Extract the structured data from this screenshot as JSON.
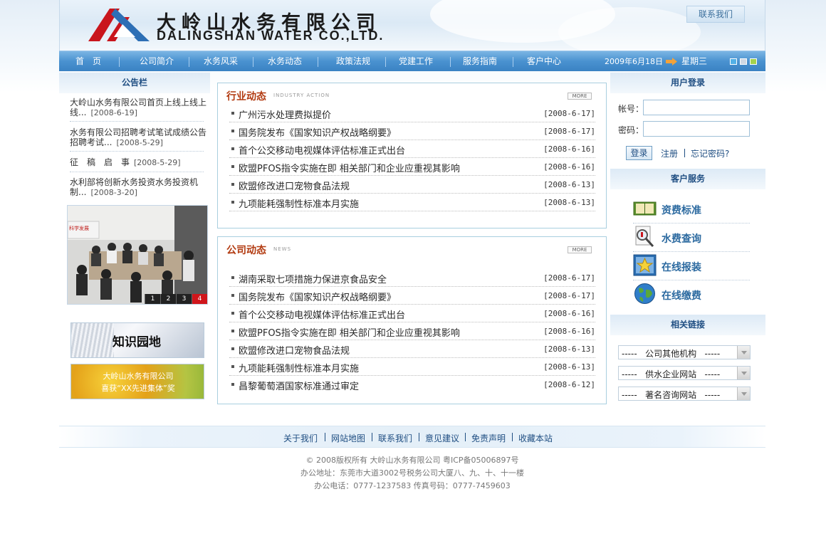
{
  "colors": {
    "nav_blue": "#4a92d0",
    "title_red": "#b23a10",
    "link_blue": "#1f4e82",
    "panel_border": "#a9cfdf"
  },
  "header": {
    "company_cn": "大岭山水务有限公司",
    "company_en": "DALINGSHAN WATER  CO.,LTD.",
    "contact_label": "联系我们",
    "logo_icon": "company-logo-icon"
  },
  "nav": {
    "items": [
      "首　页",
      "公司简介",
      "水务风采",
      "水务动态",
      "政策法规",
      "党建工作",
      "服务指南",
      "客户中心"
    ],
    "date": "2009年6月18日",
    "weekday": "星期三",
    "skin_colors": [
      "#52b0e6",
      "#cfd8e3",
      "#a3d24d"
    ]
  },
  "left": {
    "header": "公告栏",
    "notices": [
      {
        "text": "大岭山水务有限公司首页上线上线上线...",
        "date": "[2008-6-19]"
      },
      {
        "text": "水务有限公司招聘考试笔试成绩公告招聘考试...",
        "date": "[2008-5-29]"
      },
      {
        "text": "征　稿　启　事",
        "date": "[2008-5-29]"
      },
      {
        "text": "水利部将创新水务投资水务投资机制...",
        "date": "[2008-3-20]"
      }
    ],
    "pager": [
      "1",
      "2",
      "3",
      "4"
    ],
    "banner1": "知识园地",
    "banner2_line1": "大岭山水务有限公司",
    "banner2_line2": "喜获“XX先进集体”奖"
  },
  "industry": {
    "title": "行业动态",
    "subtitle": "INDUSTRY ACTION",
    "more": "MORE",
    "items": [
      {
        "title": "广州污水处理费拟提价",
        "date": "[2008-6-17]"
      },
      {
        "title": "国务院发布《国家知识产权战略纲要》",
        "date": "[2008-6-17]"
      },
      {
        "title": "首个公交移动电视媒体评估标准正式出台",
        "date": "[2008-6-16]"
      },
      {
        "title": "欧盟PFOS指令实施在即 相关部门和企业应重视其影响",
        "date": "[2008-6-16]"
      },
      {
        "title": "欧盟修改进口宠物食品法规",
        "date": "[2008-6-13]"
      },
      {
        "title": "九项能耗强制性标准本月实施",
        "date": "[2008-6-13]"
      }
    ]
  },
  "company_news": {
    "title": "公司动态",
    "subtitle": "NEWS",
    "more": "MORE",
    "items": [
      {
        "title": "湖南采取七项措施力保进京食品安全",
        "date": "[2008-6-17]"
      },
      {
        "title": "国务院发布《国家知识产权战略纲要》",
        "date": "[2008-6-17]"
      },
      {
        "title": "首个公交移动电视媒体评估标准正式出台",
        "date": "[2008-6-16]"
      },
      {
        "title": "欧盟PFOS指令实施在即 相关部门和企业应重视其影响",
        "date": "[2008-6-16]"
      },
      {
        "title": "欧盟修改进口宠物食品法规",
        "date": "[2008-6-13]"
      },
      {
        "title": "九项能耗强制性标准本月实施",
        "date": "[2008-6-13]"
      },
      {
        "title": "昌黎葡萄酒国家标准通过审定",
        "date": "[2008-6-12]"
      }
    ]
  },
  "right": {
    "login_header": "用户登录",
    "account_label": "帐号：",
    "password_label": "密码：",
    "login_button": "登录",
    "register": "注册",
    "forget": "忘记密码?",
    "service_header": "客户服务",
    "services": [
      {
        "label": "资费标准",
        "icon": "book-icon"
      },
      {
        "label": "水费查询",
        "icon": "magnifier-icon"
      },
      {
        "label": "在线报装",
        "icon": "star-icon"
      },
      {
        "label": "在线缴费",
        "icon": "globe-icon"
      }
    ],
    "links_header": "相关链接",
    "selects": [
      "-----   公司其他机构   -----",
      "-----   供水企业网站   -----",
      "-----   著名咨询网站   -----"
    ]
  },
  "footer": {
    "links": [
      "关于我们",
      "网站地图",
      "联系我们",
      "意见建议",
      "免责声明",
      "收藏本站"
    ],
    "copyright": "© 2008版权所有  大岭山水务有限公司  粤ICP备05006897号",
    "address": "办公地址：东莞市大道3002号税务公司大厦八、九、十、十一楼",
    "phone": "办公电话：0777-1237583      传真号码：0777-7459603"
  }
}
